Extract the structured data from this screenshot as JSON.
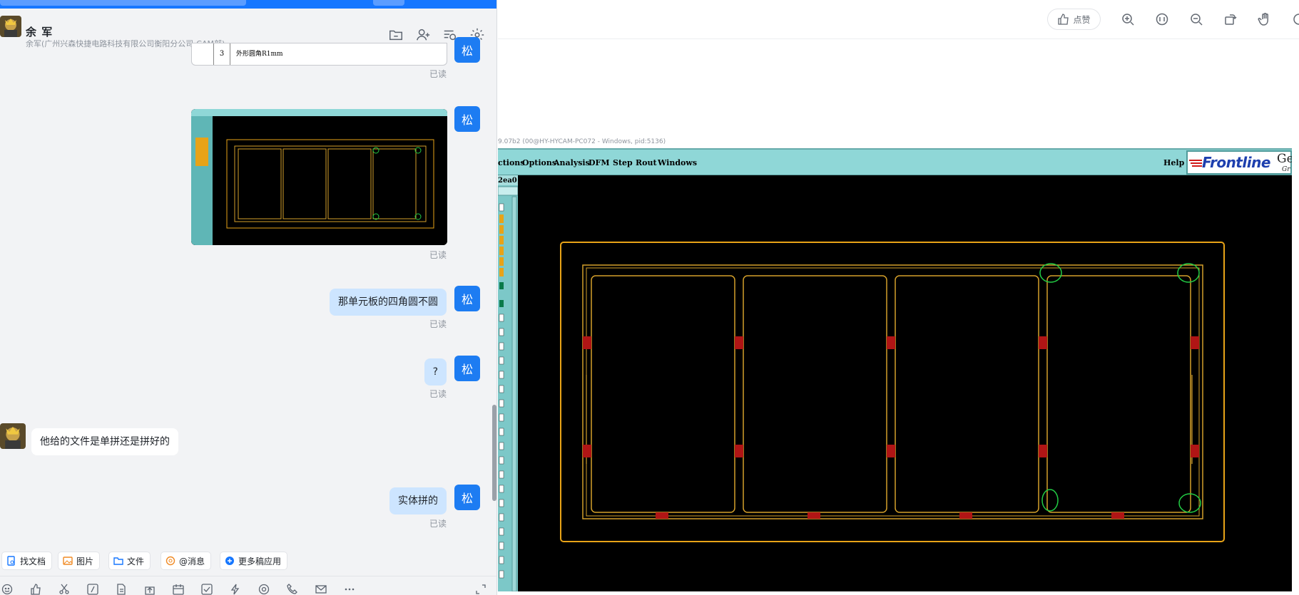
{
  "chat": {
    "header": {
      "name": "余 军",
      "subtitle": "余军(广州兴森快捷电路科技有限公司衡阳分公司-CAM部)"
    },
    "self_avatar_text": "松",
    "table_row": {
      "num": "3",
      "text": "外形圆角R1mm"
    },
    "read_label": "已读",
    "messages": [
      {
        "side": "right",
        "text": "那单元板的四角圆不圆"
      },
      {
        "side": "right",
        "text": "?"
      },
      {
        "side": "left",
        "text": "他给的文件是单拼还是拼好的"
      },
      {
        "side": "right",
        "text": "实体拼的"
      }
    ],
    "quick_actions": [
      "找文档",
      "图片",
      "文件",
      "@消息",
      "更多稿应用"
    ],
    "colors": {
      "accent": "#1677ff",
      "self_bubble": "#cde5ff"
    }
  },
  "viewer": {
    "like_label": "点赞",
    "toolbar_icons": [
      "zoom-in-icon",
      "fit-screen-icon",
      "zoom-out-icon",
      "rotate-icon",
      "hand-icon"
    ],
    "cam": {
      "title_fragment": "9.07b2 (00@HY-HYCAM-PC072 - Windows, pid:5136)",
      "menus": [
        "ctions",
        "Options",
        "Analysis",
        "DFM",
        "Step",
        "Rout",
        "Windows"
      ],
      "help": "Help",
      "logo": "Frontline",
      "logo_suffix": "Gen",
      "logo_sub": "Gr",
      "left_label": "2ea0",
      "colors": {
        "menubar": "#8fd7d7",
        "outline": "#e8a317",
        "inner": "#d4a02a",
        "pad": "#d11a1a",
        "highlight": "#22cc44"
      }
    }
  }
}
